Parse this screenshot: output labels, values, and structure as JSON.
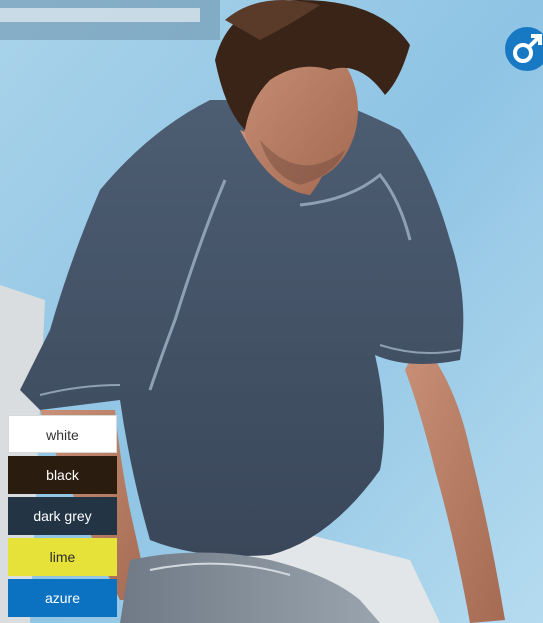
{
  "colors": {
    "white": "#ffffff",
    "black": "#2b1c10",
    "dark_grey": "#233444",
    "lime": "#e6e23a",
    "azure": "#0a72c0",
    "badge": "#1779c4"
  },
  "product": {
    "photo_icon": "man-in-dark-grey-tshirt-photo",
    "gender_icon": "male-symbol-icon"
  },
  "swatches": [
    {
      "label": "white"
    },
    {
      "label": "black"
    },
    {
      "label": "dark grey"
    },
    {
      "label": "lime"
    },
    {
      "label": "azure"
    }
  ]
}
